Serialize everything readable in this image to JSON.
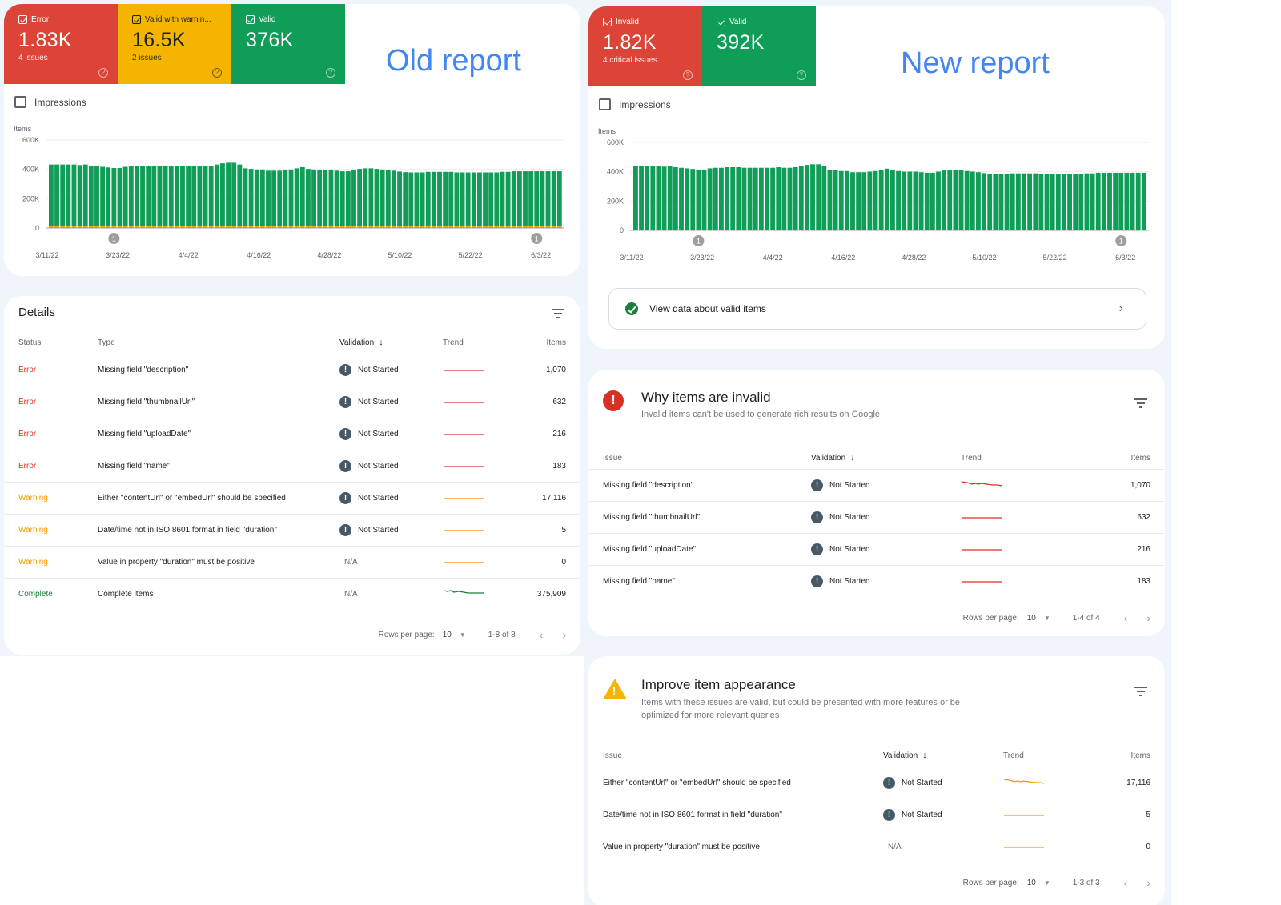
{
  "old_report": {
    "heading": "Old report",
    "tiles": [
      {
        "label": "Error",
        "value": "1.83K",
        "sub": "4 issues",
        "color": "#db4437"
      },
      {
        "label": "Valid with warnin...",
        "value": "16.5K",
        "sub": "2 issues",
        "color": "#f4b400"
      },
      {
        "label": "Valid",
        "value": "376K",
        "sub": "",
        "color": "#0f9d58"
      }
    ],
    "impressions_label": "Impressions",
    "details": {
      "title": "Details",
      "columns": [
        "Status",
        "Type",
        "Validation",
        "Trend",
        "Items"
      ],
      "rows": [
        {
          "status": "Error",
          "type": "Missing field \"description\"",
          "validation": "Not Started",
          "items": "1,070"
        },
        {
          "status": "Error",
          "type": "Missing field \"thumbnailUrl\"",
          "validation": "Not Started",
          "items": "632"
        },
        {
          "status": "Error",
          "type": "Missing field \"uploadDate\"",
          "validation": "Not Started",
          "items": "216"
        },
        {
          "status": "Error",
          "type": "Missing field \"name\"",
          "validation": "Not Started",
          "items": "183"
        },
        {
          "status": "Warning",
          "type": "Either \"contentUrl\" or \"embedUrl\" should be specified",
          "validation": "Not Started",
          "items": "17,116"
        },
        {
          "status": "Warning",
          "type": "Date/time not in ISO 8601 format in field \"duration\"",
          "validation": "Not Started",
          "items": "5"
        },
        {
          "status": "Warning",
          "type": "Value in property \"duration\" must be positive",
          "validation": "N/A",
          "items": "0"
        },
        {
          "status": "Complete",
          "type": "Complete items",
          "validation": "N/A",
          "items": "375,909"
        }
      ],
      "pager": {
        "rows_per_page_label": "Rows per page:",
        "rows_per_page": "10",
        "range": "1-8 of 8"
      }
    }
  },
  "new_report": {
    "heading": "New report",
    "tiles": [
      {
        "label": "Invalid",
        "value": "1.82K",
        "sub": "4 critical issues",
        "color": "#db4437"
      },
      {
        "label": "Valid",
        "value": "392K",
        "sub": "",
        "color": "#0f9d58"
      }
    ],
    "impressions_label": "Impressions",
    "valid_link": "View data about valid items",
    "invalid": {
      "title": "Why items are invalid",
      "subtitle": "Invalid items can't be used to generate rich results on Google",
      "columns": [
        "Issue",
        "Validation",
        "Trend",
        "Items"
      ],
      "rows": [
        {
          "issue": "Missing field \"description\"",
          "validation": "Not Started",
          "items": "1,070"
        },
        {
          "issue": "Missing field \"thumbnailUrl\"",
          "validation": "Not Started",
          "items": "632"
        },
        {
          "issue": "Missing field \"uploadDate\"",
          "validation": "Not Started",
          "items": "216"
        },
        {
          "issue": "Missing field \"name\"",
          "validation": "Not Started",
          "items": "183"
        }
      ],
      "pager": {
        "rows_per_page_label": "Rows per page:",
        "rows_per_page": "10",
        "range": "1-4 of 4"
      }
    },
    "improve": {
      "title": "Improve item appearance",
      "subtitle_line1": "Items with these issues are valid, but could be presented with more features or be",
      "subtitle_line2": "optimized for more relevant queries",
      "columns": [
        "Issue",
        "Validation",
        "Trend",
        "Items"
      ],
      "rows": [
        {
          "issue": "Either \"contentUrl\" or \"embedUrl\" should be specified",
          "validation": "Not Started",
          "items": "17,116"
        },
        {
          "issue": "Date/time not in ISO 8601 format in field \"duration\"",
          "validation": "Not Started",
          "items": "5"
        },
        {
          "issue": "Value in property \"duration\" must be positive",
          "validation": "N/A",
          "items": "0"
        }
      ],
      "pager": {
        "rows_per_page_label": "Rows per page:",
        "rows_per_page": "10",
        "range": "1-3 of 3"
      }
    }
  },
  "colors": {
    "error": "#d93025",
    "warning": "#f29900",
    "valid": "#0f9d58",
    "accent": "#4285f4"
  },
  "chart_data": [
    {
      "type": "bar",
      "title": "Old report",
      "ylabel": "Items",
      "ylim": [
        0,
        600000
      ],
      "yticks": [
        "0",
        "200K",
        "400K",
        "600K"
      ],
      "xticks": [
        "3/11/22",
        "3/23/22",
        "4/4/22",
        "4/16/22",
        "4/28/22",
        "5/10/22",
        "5/22/22",
        "6/3/22"
      ],
      "annotations": [
        {
          "label": "1",
          "x_index": 11
        },
        {
          "label": "1",
          "x_index": 85
        }
      ],
      "grid": true,
      "stacked": true,
      "series": [
        {
          "name": "Error",
          "color": "#db4437",
          "values_constant": 1830
        },
        {
          "name": "Valid with warnings",
          "color": "#f4b400",
          "values_constant": 16500
        },
        {
          "name": "Valid",
          "color": "#0f9d58",
          "values": [
            418000,
            418000,
            418000,
            418000,
            418000,
            414000,
            418000,
            410000,
            406000,
            402000,
            398000,
            394000,
            394000,
            402000,
            406000,
            406000,
            410000,
            410000,
            410000,
            406000,
            406000,
            406000,
            406000,
            406000,
            406000,
            410000,
            406000,
            406000,
            410000,
            418000,
            426000,
            430000,
            430000,
            418000,
            392000,
            388000,
            384000,
            384000,
            376000,
            376000,
            376000,
            380000,
            384000,
            392000,
            400000,
            388000,
            384000,
            380000,
            380000,
            380000,
            376000,
            372000,
            372000,
            380000,
            388000,
            392000,
            392000,
            388000,
            384000,
            380000,
            376000,
            370000,
            366000,
            364000,
            364000,
            364000,
            368000,
            368000,
            368000,
            368000,
            368000,
            364000,
            364000,
            364000,
            364000,
            364000,
            364000,
            364000,
            364000,
            368000,
            368000,
            372000,
            372000,
            372000,
            372000,
            372000,
            372000,
            372000,
            372000,
            372000
          ]
        }
      ]
    },
    {
      "type": "bar",
      "title": "New report",
      "ylabel": "Items",
      "ylim": [
        0,
        600000
      ],
      "yticks": [
        "0",
        "200K",
        "400K",
        "600K"
      ],
      "xticks": [
        "3/11/22",
        "3/23/22",
        "4/4/22",
        "4/16/22",
        "4/28/22",
        "5/10/22",
        "5/22/22",
        "6/3/22"
      ],
      "annotations": [
        {
          "label": "1",
          "x_index": 11
        },
        {
          "label": "1",
          "x_index": 85
        }
      ],
      "grid": true,
      "stacked": true,
      "series": [
        {
          "name": "Invalid",
          "color": "#db4437",
          "values_constant": 1820
        },
        {
          "name": "Valid",
          "color": "#0f9d58",
          "values": [
            436000,
            436000,
            436000,
            436000,
            436000,
            432000,
            436000,
            428000,
            424000,
            420000,
            416000,
            412000,
            412000,
            420000,
            424000,
            424000,
            428000,
            428000,
            428000,
            424000,
            424000,
            424000,
            424000,
            424000,
            424000,
            428000,
            424000,
            424000,
            428000,
            436000,
            444000,
            448000,
            448000,
            436000,
            410000,
            406000,
            402000,
            402000,
            394000,
            394000,
            394000,
            398000,
            402000,
            410000,
            418000,
            406000,
            402000,
            398000,
            398000,
            398000,
            394000,
            390000,
            390000,
            398000,
            406000,
            410000,
            410000,
            406000,
            402000,
            398000,
            394000,
            388000,
            384000,
            382000,
            382000,
            382000,
            386000,
            386000,
            386000,
            386000,
            386000,
            382000,
            382000,
            382000,
            382000,
            382000,
            382000,
            382000,
            382000,
            386000,
            386000,
            390000,
            390000,
            390000,
            390000,
            390000,
            390000,
            390000,
            390000,
            390000
          ]
        }
      ]
    }
  ]
}
